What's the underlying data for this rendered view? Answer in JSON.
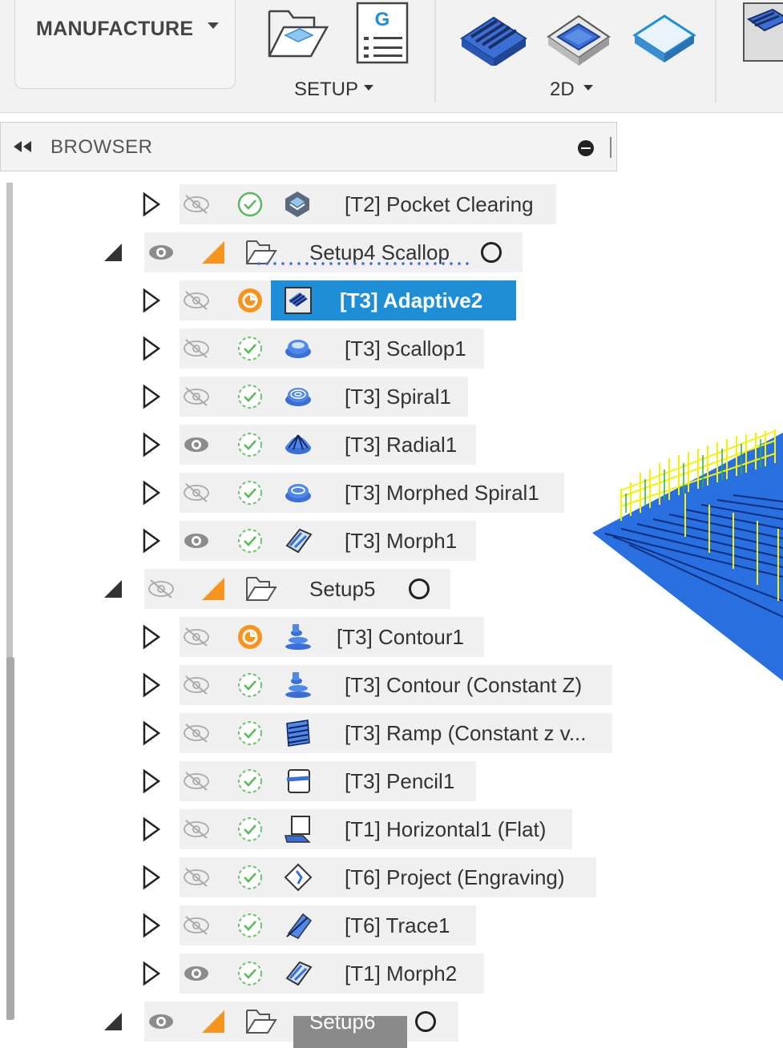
{
  "toolbar": {
    "workspace": "MANUFACTURE",
    "groups": [
      {
        "label": "SETUP"
      },
      {
        "label": "2D"
      }
    ],
    "gcode_letter": "G"
  },
  "browser": {
    "title": "BROWSER"
  },
  "tree": {
    "rows": [
      {
        "kind": "op",
        "label": "[T2] Pocket Clearing",
        "visible": false,
        "status": "ok",
        "icon": "pocket-clearing-icon"
      },
      {
        "kind": "setup",
        "label": "Setup4 Scallop",
        "visible": true,
        "icon": "setup-folder-icon"
      },
      {
        "kind": "op",
        "label": "[T3] Adaptive2",
        "visible": false,
        "status": "pending",
        "icon": "adaptive-icon",
        "selected": true
      },
      {
        "kind": "op",
        "label": "[T3] Scallop1",
        "visible": false,
        "status": "ok-dashed",
        "icon": "scallop-icon"
      },
      {
        "kind": "op",
        "label": "[T3] Spiral1",
        "visible": false,
        "status": "ok-dashed",
        "icon": "spiral-icon"
      },
      {
        "kind": "op",
        "label": "[T3] Radial1",
        "visible": true,
        "status": "ok-dashed",
        "icon": "radial-icon"
      },
      {
        "kind": "op",
        "label": "[T3] Morphed Spiral1",
        "visible": false,
        "status": "ok-dashed",
        "icon": "morphed-spiral-icon"
      },
      {
        "kind": "op",
        "label": "[T3] Morph1",
        "visible": true,
        "status": "ok-dashed",
        "icon": "morph-icon"
      },
      {
        "kind": "setup",
        "label": "Setup5",
        "visible": false,
        "icon": "setup-folder-icon"
      },
      {
        "kind": "op",
        "label": "[T3] Contour1",
        "visible": false,
        "status": "pending",
        "icon": "contour-icon"
      },
      {
        "kind": "op",
        "label": "[T3] Contour (Constant Z)",
        "visible": false,
        "status": "ok-dashed",
        "icon": "contour-icon"
      },
      {
        "kind": "op",
        "label": "[T3] Ramp (Constant z v...",
        "visible": false,
        "status": "ok-dashed",
        "icon": "ramp-icon"
      },
      {
        "kind": "op",
        "label": "[T3] Pencil1",
        "visible": false,
        "status": "ok-dashed",
        "icon": "pencil-icon"
      },
      {
        "kind": "op",
        "label": "[T1] Horizontal1 (Flat)",
        "visible": false,
        "status": "ok-dashed",
        "icon": "horizontal-icon"
      },
      {
        "kind": "op",
        "label": "[T6] Project (Engraving)",
        "visible": false,
        "status": "ok-dashed",
        "icon": "project-icon"
      },
      {
        "kind": "op",
        "label": "[T6] Trace1",
        "visible": false,
        "status": "ok-dashed",
        "icon": "trace-icon"
      },
      {
        "kind": "op",
        "label": "[T1] Morph2",
        "visible": true,
        "status": "ok-dashed",
        "icon": "morph-icon"
      },
      {
        "kind": "setup",
        "label": "Setup6",
        "visible": true,
        "icon": "setup-folder-icon"
      }
    ]
  },
  "colors": {
    "selection": "#1e8fd6",
    "warning": "#f7941d",
    "check": "#5cb85c",
    "toolpath_blue": "#2a6fe0",
    "toolpath_yellow": "#f2f20c"
  }
}
